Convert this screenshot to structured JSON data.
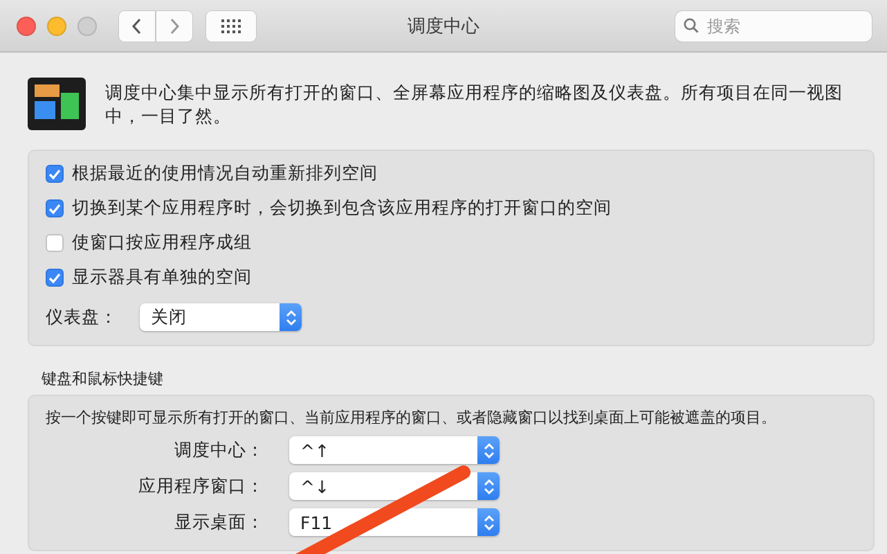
{
  "window": {
    "title": "调度中心"
  },
  "toolbar": {
    "search": {
      "placeholder": "搜索"
    }
  },
  "header": {
    "description": "调度中心集中显示所有打开的窗口、全屏幕应用程序的缩略图及仪表盘。所有项目在同一视图中，一目了然。"
  },
  "options": [
    {
      "label": "根据最近的使用情况自动重新排列空间",
      "checked": true
    },
    {
      "label": "切换到某个应用程序时，会切换到包含该应用程序的打开窗口的空间",
      "checked": true
    },
    {
      "label": "使窗口按应用程序成组",
      "checked": false
    },
    {
      "label": "显示器具有单独的空间",
      "checked": true
    }
  ],
  "dashboard": {
    "label": "仪表盘：",
    "value": "关闭"
  },
  "shortcuts": {
    "title": "键盘和鼠标快捷键",
    "description": "按一个按键即可显示所有打开的窗口、当前应用程序的窗口、或者隐藏窗口以找到桌面上可能被遮盖的项目。",
    "rows": [
      {
        "label": "调度中心：",
        "value": "^↑"
      },
      {
        "label": "应用程序窗口：",
        "value": "^↓"
      },
      {
        "label": "显示桌面：",
        "value": "F11"
      }
    ]
  }
}
